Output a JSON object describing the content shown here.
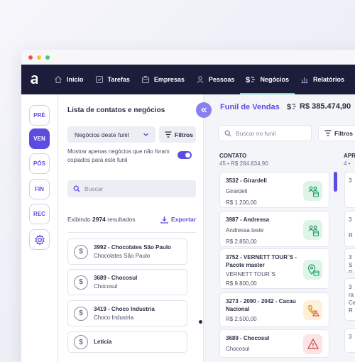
{
  "nav": {
    "items": [
      {
        "label": "Início",
        "icon": "home-icon"
      },
      {
        "label": "Tarefas",
        "icon": "tasks-icon"
      },
      {
        "label": "Empresas",
        "icon": "building-icon"
      },
      {
        "label": "Pessoas",
        "icon": "person-icon"
      },
      {
        "label": "Negócios",
        "icon": "dollar-icon",
        "active": true
      },
      {
        "label": "Relatórios",
        "icon": "chart-icon"
      }
    ]
  },
  "sidebar": {
    "items": [
      "PRÉ",
      "VEN",
      "PÓS",
      "FIN",
      "REC"
    ],
    "active": "VEN"
  },
  "panel": {
    "title": "Lista de contatos e negócios",
    "filter_select": "Negócios deste funil",
    "filters_label": "Filtros",
    "toggle_text": "Mostrar apenas negócios que não foram copiados para este funil",
    "search_placeholder": "Buscar",
    "results_prefix": "Exibindo",
    "results_count": "2974",
    "results_suffix": "resultados",
    "export_label": "Exportar",
    "contacts": [
      {
        "title": "3992 - Chocolates São Paulo",
        "subtitle": "Chocolates São Paulo"
      },
      {
        "title": "3689 - Chocosul",
        "subtitle": "Chocosul"
      },
      {
        "title": "3419 - Choco Industria",
        "subtitle": "Choco Industria"
      },
      {
        "title": "Letícia",
        "subtitle": ""
      }
    ]
  },
  "main": {
    "funnel_title": "Funil de Vendas",
    "total": "R$ 385.474,90",
    "search_placeholder": "Buscar no funil",
    "filters_label": "Filtros",
    "column": {
      "name": "CONTATO",
      "count": "45",
      "amount": "R$ 284.834,90"
    },
    "next_column": {
      "name": "APR",
      "count": "4"
    },
    "deals": [
      {
        "title": "3532 - Girardeli",
        "company": "Girardeli",
        "value": "R$ 1.200,00",
        "badge": "people-calendar-icon",
        "color": "#dff4e9"
      },
      {
        "title": "3987 - Andressa",
        "company": "Andressa teste",
        "value": "R$ 2.850,00",
        "badge": "people-calendar-icon",
        "color": "#dff4e9"
      },
      {
        "title": "3752 - VERNETT TOUR`S - Pacote master",
        "company": "VERNETT TOUR`S",
        "value": "R$ 9.800,00",
        "badge": "pin-calendar-icon",
        "color": "#dff4e9"
      },
      {
        "title": "3273 - 2090 - 2042 - Cacau Nacional",
        "company": "",
        "value": "R$ 2.500,00",
        "badge": "phone-alert-icon",
        "color": "#fdf0d6"
      },
      {
        "title": "3689 - Chocosul",
        "company": "Chocosul",
        "value": "",
        "badge": "alert-icon",
        "color": "#fde4e4"
      }
    ],
    "next_deals": [
      "3",
      "3",
      "R",
      "3",
      "S",
      "R",
      "3",
      "ra",
      "Ca",
      "R",
      "3"
    ]
  },
  "colors": {
    "nav_bg": "#1c1d3b",
    "accent": "#5c4de0",
    "active_underline": "#6fe0b8"
  }
}
